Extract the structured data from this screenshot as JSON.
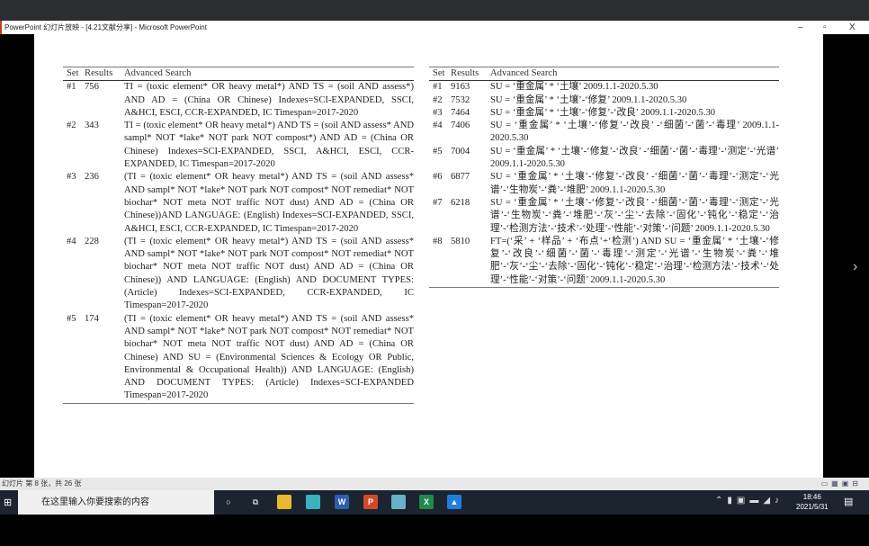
{
  "window": {
    "title": "PowerPoint 幻灯片放映 - [4.21文献分享] - Microsoft PowerPoint",
    "min": "–",
    "max": "▫",
    "close": "X"
  },
  "left_table": {
    "headers": [
      "Set",
      "Results",
      "Advanced Search"
    ],
    "rows": [
      {
        "set": "#1",
        "results": "756",
        "query": "TI = (toxic element* OR heavy metal*) AND TS = (soil AND assess*) AND AD = (China OR Chinese) Indexes=SCI-EXPANDED, SSCI, A&HCI, ESCI, CCR-EXPANDED, IC Timespan=2017-2020"
      },
      {
        "set": "#2",
        "results": "343",
        "query": "TI = (toxic element* OR heavy metal*) AND TS = (soil AND assess* AND sampl* NOT *lake* NOT park NOT compost*) AND AD = (China OR Chinese) Indexes=SCI-EXPANDED, SSCI, A&HCI, ESCI, CCR-EXPANDED, IC Timespan=2017-2020"
      },
      {
        "set": "#3",
        "results": "236",
        "query": "(TI = (toxic element* OR heavy metal*) AND TS = (soil AND assess* AND sampl* NOT *lake* NOT park NOT compost* NOT remediat* NOT biochar* NOT meta NOT traffic NOT dust) AND AD = (China OR Chinese))AND LANGUAGE: (English) Indexes=SCI-EXPANDED, SSCI, A&HCI, ESCI, CCR-EXPANDED, IC Timespan=2017-2020"
      },
      {
        "set": "#4",
        "results": "228",
        "query": "(TI = (toxic element* OR heavy metal*) AND TS = (soil AND assess* AND sampl* NOT *lake* NOT park NOT compost* NOT remediat* NOT biochar* NOT meta NOT traffic NOT dust) AND AD = (China OR Chinese)) AND LANGUAGE: (English) AND DOCUMENT TYPES: (Article) Indexes=SCI-EXPANDED, CCR-EXPANDED, IC Timespan=2017-2020"
      },
      {
        "set": "#5",
        "results": "174",
        "query": "(TI = (toxic element* OR heavy metal*) AND TS = (soil AND assess* AND sampl* NOT *lake* NOT park NOT compost* NOT remediat* NOT biochar* NOT meta NOT traffic NOT dust) AND AD = (China OR Chinese) AND SU = (Environmental Sciences & Ecology OR Public, Environmental & Occupational Health)) AND LANGUAGE: (English) AND DOCUMENT TYPES: (Article) Indexes=SCI-EXPANDED Timespan=2017-2020"
      }
    ]
  },
  "right_table": {
    "headers": [
      "Set",
      "Results",
      "Advanced Search"
    ],
    "rows": [
      {
        "set": "#1",
        "results": "9163",
        "query": "SU = ‘重金属’ * ‘土壤’ 2009.1.1-2020.5.30"
      },
      {
        "set": "#2",
        "results": "7532",
        "query": "SU = ‘重金属’ * ‘土壤’-‘修复’ 2009.1.1-2020.5.30"
      },
      {
        "set": "#3",
        "results": "7464",
        "query": "SU = ‘重金属’ * ‘土壤’-‘修复’-‘改良’  2009.1.1-2020.5.30"
      },
      {
        "set": "#4",
        "results": "7406",
        "query": "SU = ‘重金属’ * ‘土壤’-‘修复’-‘改良’ -‘细菌’-‘菌’-‘毒理’ 2009.1.1-2020.5.30"
      },
      {
        "set": "#5",
        "results": "7004",
        "query": "SU = ‘重金属’ * ‘土壤’-‘修复’-‘改良’ -‘细菌’-‘菌’-‘毒理’-‘测定’-‘光谱’ 2009.1.1-2020.5.30"
      },
      {
        "set": "#6",
        "results": "6877",
        "query": "SU = ‘重金属’ * ‘土壤’-‘修复’-‘改良’ -‘细菌’-‘菌’-‘毒理’-‘测定’-‘光谱’-‘生物炭’-‘粪’-‘堆肥’ 2009.1.1-2020.5.30"
      },
      {
        "set": "#7",
        "results": "6218",
        "query": "SU = ‘重金属’ * ‘土壤’-‘修复’-‘改良’ -‘细菌’-‘菌’-‘毒理’-‘测定’-‘光谱’-‘生物炭’-‘粪’-‘堆肥’-‘灰’-‘尘’-‘去除’-‘固化’-‘钝化’-‘稳定’-‘治理’-‘检测方法’-‘技术’-‘处理’-‘性能’-‘对策’-‘问题’ 2009.1.1-2020.5.30"
      },
      {
        "set": "#8",
        "results": "5810",
        "query": "FT=(‘采’ + ‘样品’ + ‘布点’+‘检测’) AND SU = ‘重金属’ * ‘土壤’-‘修复’-‘改良’-‘细菌’-‘菌’-‘毒理’-‘测定’-‘光谱’-‘生物炭’-‘粪’-‘堆肥’-‘灰’-‘尘’-‘去除’-‘固化’-‘钝化’-‘稳定’-‘治理’-‘检测方法’-‘技术’-‘处理’-‘性能’-‘对策’-‘问题’ 2009.1.1-2020.5.30"
      }
    ]
  },
  "status": {
    "slide_info": "幻灯片 第 8 张，共 26 张"
  },
  "taskbar": {
    "search_placeholder": "在这里输入你要搜索的内容",
    "time": "18:46",
    "date": "2021/5/31"
  }
}
